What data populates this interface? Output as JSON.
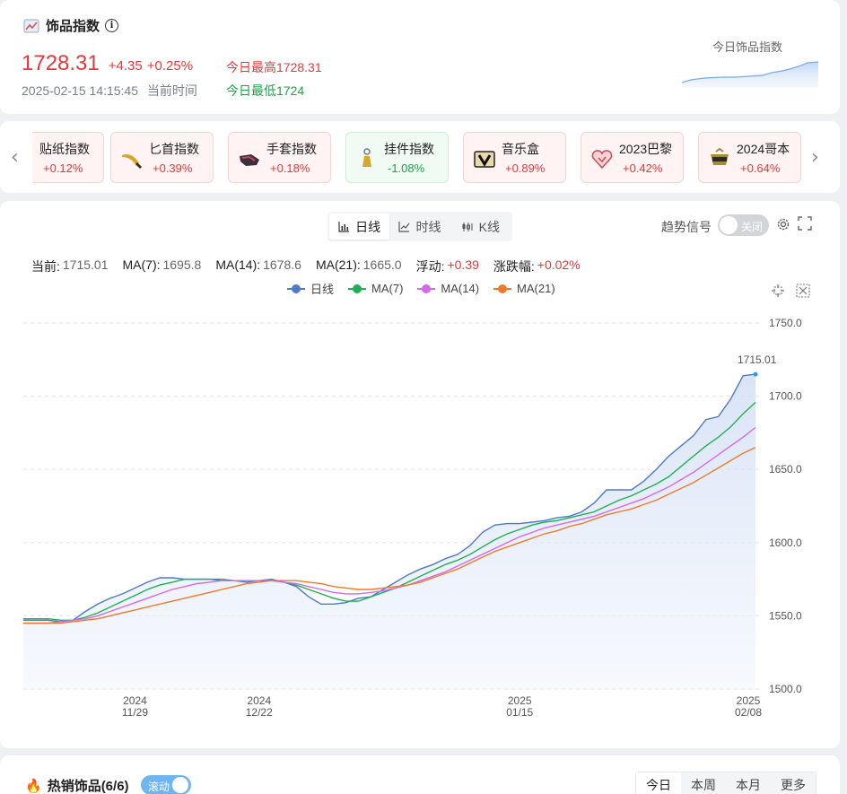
{
  "header": {
    "title": "饰品指数",
    "price": "1728.31",
    "change": "+4.35",
    "change_pct": "+0.25%",
    "time": "2025-02-15 14:15:45",
    "time_label": "当前时间",
    "high_label": "今日最高",
    "high_value": "1728.31",
    "low_label": "今日最低",
    "low_value": "1724",
    "mini_chart_label": "今日饰品指数"
  },
  "indices": [
    {
      "name": "贴纸指数",
      "change": "+0.12%",
      "trend": "up",
      "icon": "sticker-icon"
    },
    {
      "name": "匕首指数",
      "change": "+0.39%",
      "trend": "up",
      "icon": "knife-icon"
    },
    {
      "name": "手套指数",
      "change": "+0.18%",
      "trend": "up",
      "icon": "glove-icon"
    },
    {
      "name": "挂件指数",
      "change": "-1.08%",
      "trend": "down",
      "icon": "charm-icon"
    },
    {
      "name": "音乐盒",
      "change": "+0.89%",
      "trend": "up",
      "icon": "music-box-icon"
    },
    {
      "name": "2023巴黎",
      "change": "+0.42%",
      "trend": "up",
      "icon": "paris-2023-icon"
    },
    {
      "name": "2024哥本",
      "change": "+0.64%",
      "trend": "up",
      "icon": "copenhagen-2024-icon"
    }
  ],
  "chart_controls": {
    "tabs": [
      "日线",
      "时线",
      "K线"
    ],
    "active_tab": "日线",
    "trend_signal_label": "趋势信号",
    "toggle_label": "关闭"
  },
  "stats": {
    "current_label": "当前:",
    "current": "1715.01",
    "ma7_label": "MA(7):",
    "ma7": "1695.8",
    "ma14_label": "MA(14):",
    "ma14": "1678.6",
    "ma21_label": "MA(21):",
    "ma21": "1665.0",
    "float_label": "浮动:",
    "float": "+0.39",
    "pct_label": "涨跌幅:",
    "pct": "+0.02%"
  },
  "chart_data": {
    "type": "line",
    "ylim": [
      1500,
      1750
    ],
    "yticks": [
      "1750.0",
      "1700.0",
      "1650.0",
      "1600.0",
      "1550.0",
      "1500.0"
    ],
    "xticks": [
      {
        "year": "2024",
        "date": "11/29"
      },
      {
        "year": "2024",
        "date": "12/22"
      },
      {
        "year": "2025",
        "date": "01/15"
      },
      {
        "year": "2025",
        "date": "02/08"
      }
    ],
    "last_label": "1715.01",
    "series": [
      {
        "name": "日线",
        "color": "#4e79c9",
        "values": [
          1547,
          1547,
          1547,
          1546,
          1547,
          1553,
          1558,
          1562,
          1565,
          1569,
          1573,
          1576,
          1576,
          1575,
          1575,
          1575,
          1574,
          1574,
          1573,
          1574,
          1575,
          1573,
          1570,
          1563,
          1558,
          1558,
          1559,
          1562,
          1563,
          1568,
          1573,
          1578,
          1582,
          1585,
          1589,
          1592,
          1598,
          1607,
          1612,
          1613,
          1613,
          1614,
          1615,
          1617,
          1618,
          1621,
          1627,
          1636,
          1636,
          1636,
          1642,
          1650,
          1659,
          1666,
          1673,
          1684,
          1686,
          1698,
          1714,
          1715
        ]
      },
      {
        "name": "MA(7)",
        "color": "#1fb050",
        "values": [
          1548,
          1548,
          1548,
          1547,
          1547,
          1549,
          1552,
          1556,
          1560,
          1564,
          1568,
          1571,
          1573,
          1575,
          1575,
          1575,
          1575,
          1574,
          1574,
          1574,
          1574,
          1573,
          1571,
          1568,
          1565,
          1562,
          1560,
          1560,
          1563,
          1566,
          1569,
          1573,
          1577,
          1581,
          1585,
          1588,
          1592,
          1597,
          1602,
          1606,
          1609,
          1612,
          1614,
          1615,
          1617,
          1619,
          1621,
          1625,
          1629,
          1632,
          1636,
          1640,
          1645,
          1652,
          1659,
          1666,
          1672,
          1679,
          1688,
          1695.8
        ]
      },
      {
        "name": "MA(14)",
        "color": "#d36ae8",
        "values": [
          1545,
          1545,
          1545,
          1546,
          1547,
          1548,
          1550,
          1553,
          1556,
          1559,
          1562,
          1565,
          1568,
          1570,
          1572,
          1573,
          1574,
          1574,
          1574,
          1574,
          1574,
          1573,
          1572,
          1570,
          1568,
          1566,
          1565,
          1565,
          1566,
          1567,
          1569,
          1571,
          1574,
          1577,
          1580,
          1584,
          1588,
          1592,
          1596,
          1600,
          1604,
          1607,
          1610,
          1612,
          1614,
          1616,
          1618,
          1621,
          1624,
          1627,
          1630,
          1634,
          1638,
          1643,
          1648,
          1654,
          1660,
          1666,
          1672,
          1678.6
        ]
      },
      {
        "name": "MA(21)",
        "color": "#ee7a2c",
        "values": [
          1545,
          1545,
          1545,
          1545,
          1546,
          1547,
          1548,
          1550,
          1552,
          1554,
          1556,
          1558,
          1560,
          1562,
          1564,
          1566,
          1568,
          1570,
          1572,
          1573,
          1574,
          1574,
          1574,
          1573,
          1572,
          1570,
          1569,
          1568,
          1568,
          1569,
          1570,
          1571,
          1573,
          1576,
          1579,
          1582,
          1586,
          1590,
          1594,
          1597,
          1600,
          1603,
          1606,
          1608,
          1611,
          1613,
          1616,
          1619,
          1621,
          1623,
          1626,
          1629,
          1633,
          1637,
          1641,
          1646,
          1651,
          1656,
          1661,
          1665.0
        ]
      }
    ]
  },
  "bottom": {
    "title": "热销饰品(6/6)",
    "scroll_label": "滚动",
    "period_tabs": [
      "今日",
      "本周",
      "本月",
      "更多"
    ]
  }
}
